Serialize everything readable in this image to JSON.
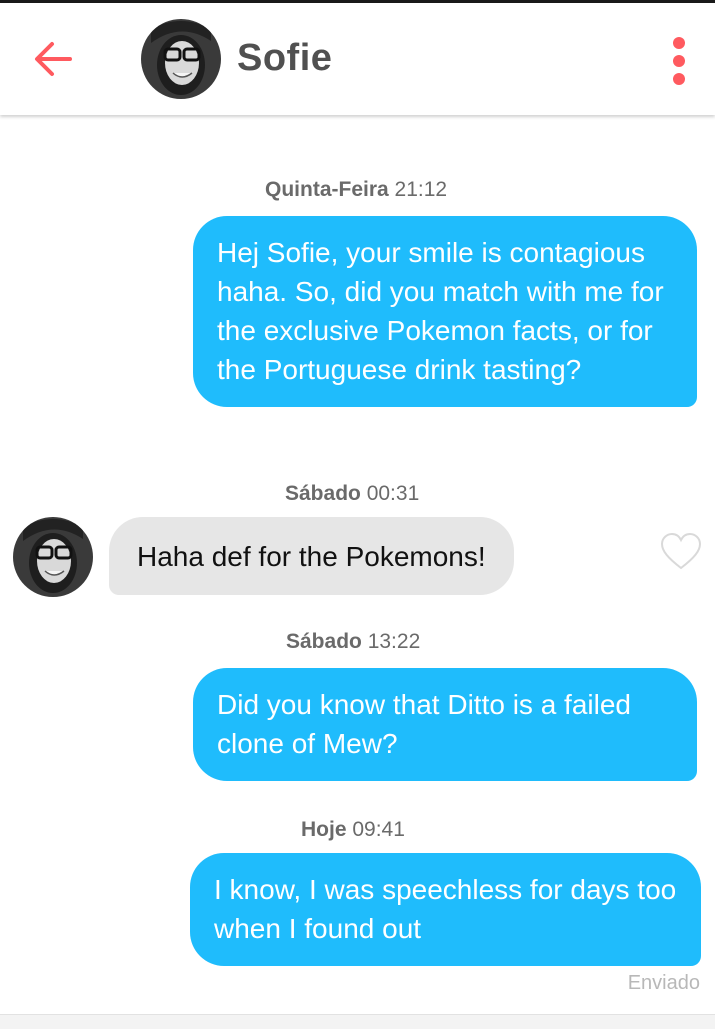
{
  "header": {
    "contact_name": "Sofie",
    "back_icon": "arrow-left-icon",
    "menu_icon": "more-vertical-icon",
    "accent_color": "#ff5a5f"
  },
  "messages": [
    {
      "day": "Quinta-Feira",
      "time": "21:12",
      "direction": "outgoing",
      "text": "Hej Sofie, your smile is contagious haha. So, did you match with me for the exclusive Pokemon facts, or for the Portuguese drink tasting?"
    },
    {
      "day": "Sábado",
      "time": "00:31",
      "direction": "incoming",
      "text": "Haha def for the Pokemons!"
    },
    {
      "day": "Sábado",
      "time": "13:22",
      "direction": "outgoing",
      "text": "Did you know that Ditto is a failed clone of Mew?"
    },
    {
      "day": "Hoje",
      "time": "09:41",
      "direction": "outgoing",
      "text": "I know, I was speechless for days too when I found out"
    }
  ],
  "status": {
    "sent_label": "Enviado"
  },
  "colors": {
    "outgoing_bubble": "#1fbcfc",
    "incoming_bubble": "#e6e6e6"
  }
}
